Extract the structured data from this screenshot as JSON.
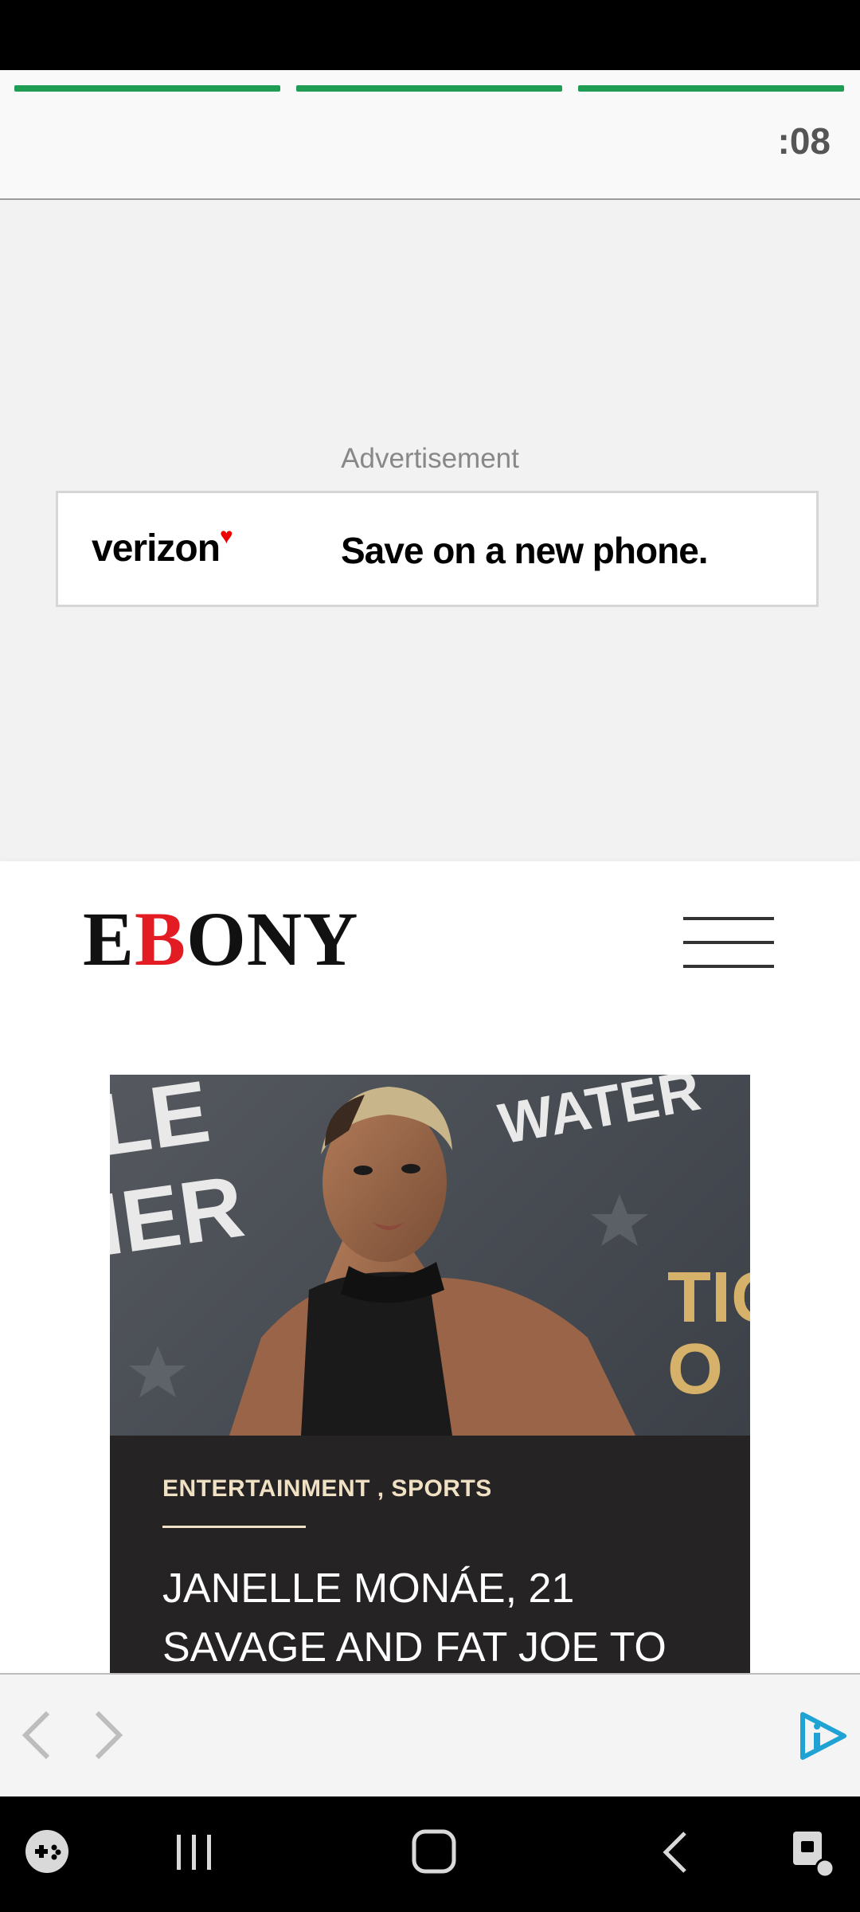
{
  "story": {
    "timer": ":08",
    "segments": [
      1,
      1,
      1
    ]
  },
  "ad": {
    "label": "Advertisement",
    "brand": "verizon",
    "tagline": "Save on a new phone."
  },
  "site": {
    "logo_letters": [
      "E",
      "B",
      "ONY"
    ]
  },
  "article": {
    "categories": "ENTERTAINMENT , SPORTS",
    "headline": "JANELLE MONÁE, 21 SAVAGE AND FAT JOE TO"
  },
  "photo_backdrop": {
    "left_text": "LE\nIER",
    "right_top_text": "WATER",
    "right_side_text": "TIC\nO"
  },
  "colors": {
    "progress": "#1f9d55",
    "logo_accent": "#e31b23",
    "card_bg": "#252323",
    "category": "#f0e0c4"
  },
  "browser_bar": {
    "icons": [
      "back-arrow-icon",
      "forward-arrow-icon",
      "play-info-icon"
    ]
  },
  "system_nav": {
    "icons": [
      "game-launcher-icon",
      "recents-icon",
      "home-icon",
      "back-icon",
      "screen-lock-icon"
    ]
  }
}
